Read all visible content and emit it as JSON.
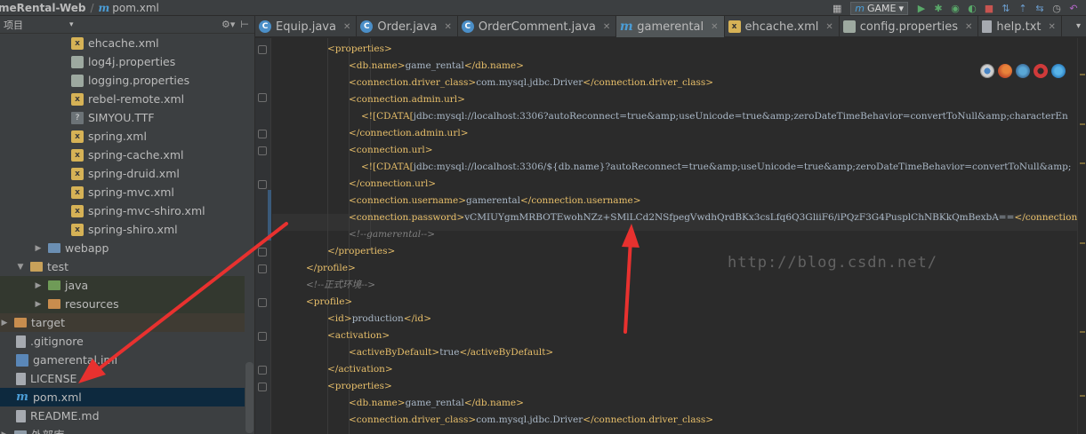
{
  "nav": {
    "project": "meRental-Web",
    "file": "pom.xml"
  },
  "toolbar": {
    "run_config": "GAME"
  },
  "project_panel": {
    "header": "项目",
    "rows": [
      {
        "label": "ehcache.xml",
        "icon": "xml"
      },
      {
        "label": "log4j.properties",
        "icon": "props"
      },
      {
        "label": "logging.properties",
        "icon": "props"
      },
      {
        "label": "rebel-remote.xml",
        "icon": "xml"
      },
      {
        "label": "SIMYOU.TTF",
        "icon": "ttf"
      },
      {
        "label": "spring.xml",
        "icon": "xml"
      },
      {
        "label": "spring-cache.xml",
        "icon": "xml"
      },
      {
        "label": "spring-druid.xml",
        "icon": "xml"
      },
      {
        "label": "spring-mvc.xml",
        "icon": "xml"
      },
      {
        "label": "spring-mvc-shiro.xml",
        "icon": "xml"
      },
      {
        "label": "spring-shiro.xml",
        "icon": "xml"
      },
      {
        "label": "webapp",
        "icon": "folder-blue"
      },
      {
        "label": "test",
        "icon": "folder"
      },
      {
        "label": "java",
        "icon": "folder-green"
      },
      {
        "label": "resources",
        "icon": "folder-orange"
      },
      {
        "label": "target",
        "icon": "folder-orange"
      },
      {
        "label": ".gitignore",
        "icon": "file"
      },
      {
        "label": "gamerental.iml",
        "icon": "iml"
      },
      {
        "label": "LICENSE",
        "icon": "file"
      },
      {
        "label": "pom.xml",
        "icon": "maven"
      },
      {
        "label": "README.md",
        "icon": "file"
      },
      {
        "label": "外部库",
        "icon": "library"
      }
    ]
  },
  "tabs": [
    {
      "label": "Equip.java",
      "icon": "class"
    },
    {
      "label": "Order.java",
      "icon": "class"
    },
    {
      "label": "OrderComment.java",
      "icon": "class"
    },
    {
      "label": "gamerental",
      "icon": "maven",
      "active": true
    },
    {
      "label": "ehcache.xml",
      "icon": "xml"
    },
    {
      "label": "config.properties",
      "icon": "props"
    },
    {
      "label": "help.txt",
      "icon": "text"
    }
  ],
  "code": [
    {
      "indent": 2,
      "parts": [
        [
          "tg",
          "<properties>"
        ]
      ]
    },
    {
      "indent": 3,
      "parts": [
        [
          "tg",
          "<db.name>"
        ],
        [
          "tx",
          "game_rental"
        ],
        [
          "tg",
          "</db.name>"
        ]
      ]
    },
    {
      "indent": 3,
      "parts": [
        [
          "tg",
          "<connection.driver_class>"
        ],
        [
          "tx",
          "com.mysql.jdbc.Driver"
        ],
        [
          "tg",
          "</connection.driver_class>"
        ]
      ]
    },
    {
      "indent": 3,
      "parts": [
        [
          "tg",
          "<connection.admin.url>"
        ]
      ]
    },
    {
      "indent": 4,
      "parts": [
        [
          "tg",
          "<![CDATA["
        ],
        [
          "tx",
          "jdbc:mysql://localhost:3306?autoReconnect=true&amp;useUnicode=true&amp;zeroDateTimeBehavior=convertToNull&amp;characterEn"
        ]
      ]
    },
    {
      "indent": 3,
      "parts": [
        [
          "tg",
          "</connection.admin.url>"
        ]
      ]
    },
    {
      "indent": 3,
      "parts": [
        [
          "tg",
          "<connection.url>"
        ]
      ]
    },
    {
      "indent": 4,
      "parts": [
        [
          "tg",
          "<![CDATA["
        ],
        [
          "tx",
          "jdbc:mysql://localhost:3306/${db.name}?autoReconnect=true&amp;useUnicode=true&amp;zeroDateTimeBehavior=convertToNull&amp;"
        ]
      ]
    },
    {
      "indent": 3,
      "parts": [
        [
          "tg",
          "</connection.url>"
        ]
      ]
    },
    {
      "indent": 3,
      "parts": [
        [
          "tg",
          "<connection.username>"
        ],
        [
          "tx",
          "gamerental"
        ],
        [
          "tg",
          "</connection.username>"
        ]
      ]
    },
    {
      "indent": 3,
      "parts": [
        [
          "tg",
          "<connection.password>"
        ],
        [
          "tx",
          "vCMIUYgmMRBOTEwohNZz+SMlLCd2NSfpegVwdhQrdBKx3csLfq6Q3GliiF6/iPQzF3G4PusplChNBKkQmBexbA=="
        ],
        [
          "tg",
          "</connection.password>"
        ]
      ]
    },
    {
      "indent": 3,
      "parts": [
        [
          "cm",
          "<!--gamerental-->"
        ]
      ]
    },
    {
      "indent": 2,
      "parts": [
        [
          "tg",
          "</properties>"
        ]
      ]
    },
    {
      "indent": 1,
      "parts": [
        [
          "tg",
          "</profile>"
        ]
      ]
    },
    {
      "indent": 1,
      "parts": [
        [
          "cm",
          "<!--正式环境-->"
        ]
      ]
    },
    {
      "indent": 1,
      "parts": [
        [
          "tg",
          "<profile>"
        ]
      ]
    },
    {
      "indent": 2,
      "parts": [
        [
          "tg",
          "<id>"
        ],
        [
          "tx",
          "production"
        ],
        [
          "tg",
          "</id>"
        ]
      ]
    },
    {
      "indent": 2,
      "parts": [
        [
          "tg",
          "<activation>"
        ]
      ]
    },
    {
      "indent": 3,
      "parts": [
        [
          "tg",
          "<activeByDefault>"
        ],
        [
          "tx",
          "true"
        ],
        [
          "tg",
          "</activeByDefault>"
        ]
      ]
    },
    {
      "indent": 2,
      "parts": [
        [
          "tg",
          "</activation>"
        ]
      ]
    },
    {
      "indent": 2,
      "parts": [
        [
          "tg",
          "<properties>"
        ]
      ]
    },
    {
      "indent": 3,
      "parts": [
        [
          "tg",
          "<db.name>"
        ],
        [
          "tx",
          "game_rental"
        ],
        [
          "tg",
          "</db.name>"
        ]
      ]
    },
    {
      "indent": 3,
      "parts": [
        [
          "tg",
          "<connection.driver_class>"
        ],
        [
          "tx",
          "com.mysql.jdbc.Driver"
        ],
        [
          "tg",
          "</connection.driver_class>"
        ]
      ]
    }
  ],
  "watermark": "http://blog.csdn.net/",
  "colors": {
    "tag": "#e8bf6a",
    "text": "#a9b7c6",
    "comment": "#808080",
    "annotation": "#e8312f"
  }
}
